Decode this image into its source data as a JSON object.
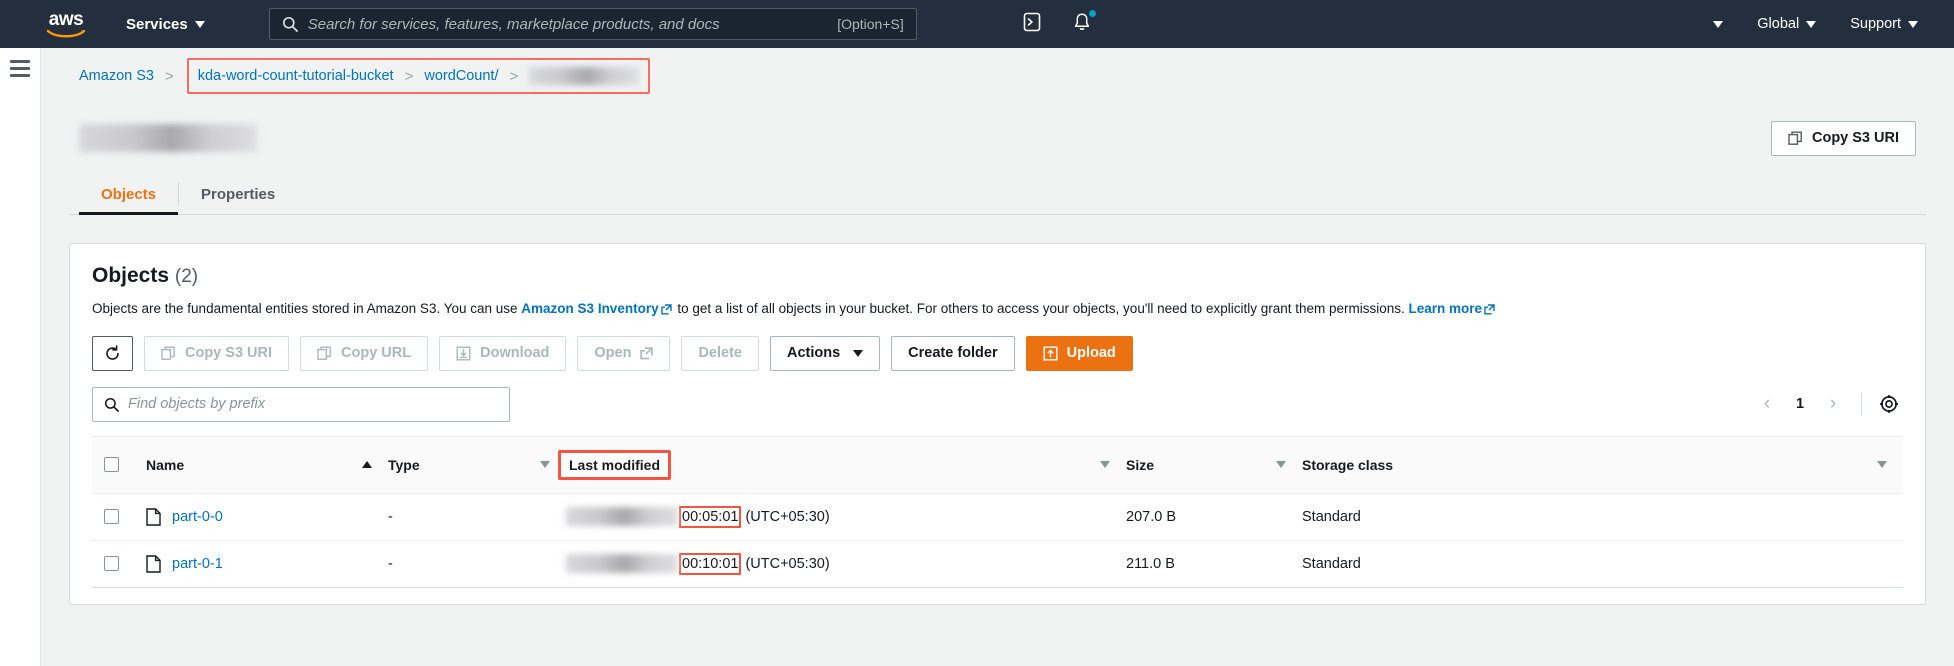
{
  "topnav": {
    "logo_alt": "aws",
    "services_label": "Services",
    "search": {
      "placeholder": "Search for services, features, marketplace products, and docs",
      "value": "",
      "shortcut": "[Option+S]"
    },
    "account_label": "",
    "region_label": "Global",
    "support_label": "Support"
  },
  "breadcrumb": {
    "items": [
      {
        "label": "Amazon S3",
        "link": true
      },
      {
        "label": "kda-word-count-tutorial-bucket",
        "link": true
      },
      {
        "label": "wordCount/",
        "link": true
      },
      {
        "label": "",
        "link": true,
        "redacted": true
      }
    ],
    "separator": ">"
  },
  "page": {
    "title": "",
    "title_redacted": true,
    "copy_s3_uri_label": "Copy S3 URI"
  },
  "tabs": [
    {
      "label": "Objects",
      "active": true
    },
    {
      "label": "Properties",
      "active": false
    }
  ],
  "objects_panel": {
    "heading": "Objects",
    "count": "(2)",
    "description_part1": "Objects are the fundamental entities stored in Amazon S3. You can use",
    "inventory_link": "Amazon S3 Inventory",
    "description_part2": "to get a list of all objects in your bucket. For others to access your objects, you'll need to explicitly grant them permissions.",
    "learn_more_link": "Learn more",
    "toolbar": {
      "refresh_label": "Refresh",
      "copy_s3_uri_label": "Copy S3 URI",
      "copy_url_label": "Copy URL",
      "download_label": "Download",
      "open_label": "Open",
      "delete_label": "Delete",
      "actions_label": "Actions",
      "create_folder_label": "Create folder",
      "upload_label": "Upload"
    },
    "filter": {
      "placeholder": "Find objects by prefix",
      "value": ""
    },
    "pagination": {
      "prev": "‹",
      "page": "1",
      "next": "›"
    },
    "table": {
      "headers": {
        "name": "Name",
        "type": "Type",
        "last_modified": "Last modified",
        "size": "Size",
        "storage_class": "Storage class"
      },
      "rows": [
        {
          "name": "part-0-0",
          "type": "-",
          "date_redacted": true,
          "time": "00:05:01",
          "timezone": "(UTC+05:30)",
          "size": "207.0 B",
          "storage_class": "Standard"
        },
        {
          "name": "part-0-1",
          "type": "-",
          "date_redacted": true,
          "time": "00:10:01",
          "timezone": "(UTC+05:30)",
          "size": "211.0 B",
          "storage_class": "Standard"
        }
      ]
    }
  },
  "colors": {
    "nav_bg": "#232f3e",
    "accent_orange": "#ec7211",
    "link_blue": "#0073bb",
    "annotation_red": "#f4553f",
    "page_bg": "#f1f3f3"
  }
}
